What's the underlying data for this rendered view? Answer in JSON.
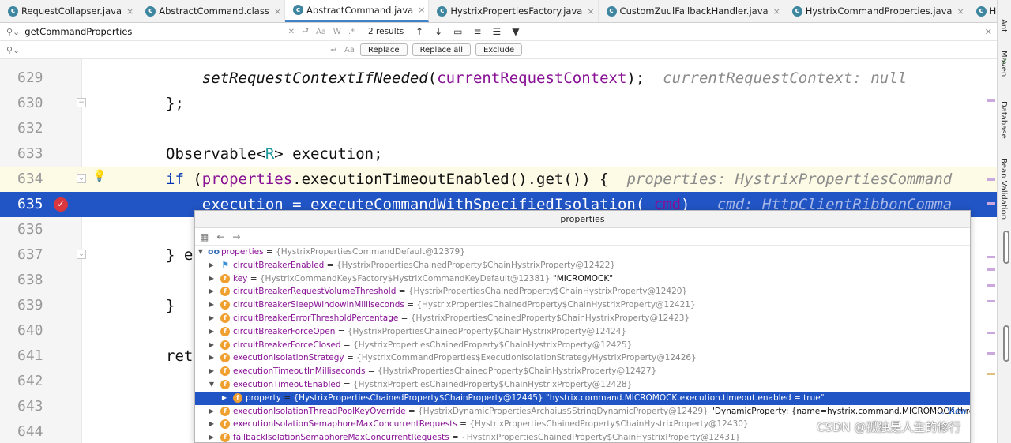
{
  "tabs": [
    {
      "label": "RequestCollapser.java",
      "active": false
    },
    {
      "label": "AbstractCommand.class",
      "active": false
    },
    {
      "label": "AbstractCommand.java",
      "active": true
    },
    {
      "label": "HystrixPropertiesFactory.java",
      "active": false
    },
    {
      "label": "CustomZuulFallbackHandler.java",
      "active": false
    },
    {
      "label": "HystrixCommandProperties.java",
      "active": false
    },
    {
      "label": "HystrixPropertiesManager.java",
      "active": false
    }
  ],
  "search": {
    "query": "getCommandProperties",
    "results": "2 results",
    "replace_value": "",
    "replace_label": "Replace",
    "replace_all_label": "Replace all",
    "exclude_label": "Exclude"
  },
  "right_panel": {
    "ant": "Ant",
    "maven": "Maven",
    "database": "Database",
    "bean_validation": "Bean Validation"
  },
  "editor": {
    "lines": [
      {
        "num": "629",
        "code": "    setRequestContextIfNeeded(currentRequestContext);",
        "hint": "currentRequestContext: null"
      },
      {
        "num": "630",
        "code": "};",
        "hint": ""
      },
      {
        "num": "632",
        "code": "",
        "hint": ""
      },
      {
        "num": "633",
        "code": "Observable<R> execution;",
        "hint": ""
      },
      {
        "num": "634",
        "code": "if (properties.executionTimeoutEnabled().get()) {",
        "hint": "properties: HystrixPropertiesCommand"
      },
      {
        "num": "635",
        "code": "    execution = executeCommandWithSpecifiedIsolation(_cmd)",
        "hint": "_cmd: HttpClientRibbonComma"
      },
      {
        "num": "636",
        "code": "",
        "hint": ""
      },
      {
        "num": "637",
        "code": "} e",
        "hint": ""
      },
      {
        "num": "638",
        "code": "",
        "hint": ""
      },
      {
        "num": "639",
        "code": "}",
        "hint": ""
      },
      {
        "num": "640",
        "code": "",
        "hint": ""
      },
      {
        "num": "641",
        "code": "ret",
        "hint": ""
      },
      {
        "num": "642",
        "code": "",
        "hint": ""
      },
      {
        "num": "643",
        "code": "",
        "hint": ""
      },
      {
        "num": "644",
        "code": "",
        "hint": ""
      }
    ]
  },
  "popup": {
    "title": "properties",
    "root": {
      "name": "properties",
      "value": "{HystrixPropertiesCommandDefault@12379}"
    },
    "rows": [
      {
        "name": "circuitBreakerEnabled",
        "value": "{HystrixPropertiesChainedProperty$ChainHystrixProperty@12422}",
        "extra": "",
        "icon": "flag",
        "expanded": false
      },
      {
        "name": "key",
        "value": "{HystrixCommandKey$Factory$HystrixCommandKeyDefault@12381}",
        "extra": "\"MICROMOCK\"",
        "icon": "f",
        "expanded": false
      },
      {
        "name": "circuitBreakerRequestVolumeThreshold",
        "value": "{HystrixPropertiesChainedProperty$ChainHystrixProperty@12420}",
        "extra": "",
        "icon": "f",
        "expanded": false
      },
      {
        "name": "circuitBreakerSleepWindowInMilliseconds",
        "value": "{HystrixPropertiesChainedProperty$ChainHystrixProperty@12421}",
        "extra": "",
        "icon": "f",
        "expanded": false
      },
      {
        "name": "circuitBreakerErrorThresholdPercentage",
        "value": "{HystrixPropertiesChainedProperty$ChainHystrixProperty@12423}",
        "extra": "",
        "icon": "f",
        "expanded": false
      },
      {
        "name": "circuitBreakerForceOpen",
        "value": "{HystrixPropertiesChainedProperty$ChainHystrixProperty@12424}",
        "extra": "",
        "icon": "f",
        "expanded": false
      },
      {
        "name": "circuitBreakerForceClosed",
        "value": "{HystrixPropertiesChainedProperty$ChainHystrixProperty@12425}",
        "extra": "",
        "icon": "f",
        "expanded": false
      },
      {
        "name": "executionIsolationStrategy",
        "value": "{HystrixCommandProperties$ExecutionIsolationStrategyHystrixProperty@12426}",
        "extra": "",
        "icon": "f",
        "expanded": false
      },
      {
        "name": "executionTimeoutInMilliseconds",
        "value": "{HystrixPropertiesChainedProperty$ChainHystrixProperty@12427}",
        "extra": "",
        "icon": "f",
        "expanded": false
      },
      {
        "name": "executionTimeoutEnabled",
        "value": "{HystrixPropertiesChainedProperty$ChainHystrixProperty@12428}",
        "extra": "",
        "icon": "f",
        "expanded": true
      },
      {
        "name": "property",
        "value": "{HystrixPropertiesChainedProperty$ChainProperty@12445}",
        "extra": "\"hystrix.command.MICROMOCK.execution.timeout.enabled = true\"",
        "icon": "f",
        "expanded": false,
        "child": true,
        "selected": true
      },
      {
        "name": "executionIsolationThreadPoolKeyOverride",
        "value": "{HystrixDynamicPropertiesArchaius$StringDynamicProperty@12429}",
        "extra": "\"DynamicProperty: {name=hystrix.command.MICROMOCK.threadPo",
        "icon": "f",
        "expanded": false,
        "view": "... View"
      },
      {
        "name": "executionIsolationSemaphoreMaxConcurrentRequests",
        "value": "{HystrixPropertiesChainedProperty$ChainHystrixProperty@12430}",
        "extra": "",
        "icon": "f",
        "expanded": false
      },
      {
        "name": "fallbackIsolationSemaphoreMaxConcurrentRequests",
        "value": "{HystrixPropertiesChainedProperty$ChainHystrixProperty@12431}",
        "extra": "",
        "icon": "f",
        "expanded": false
      }
    ]
  },
  "watermark": "CSDN @孤独是人生的修行"
}
